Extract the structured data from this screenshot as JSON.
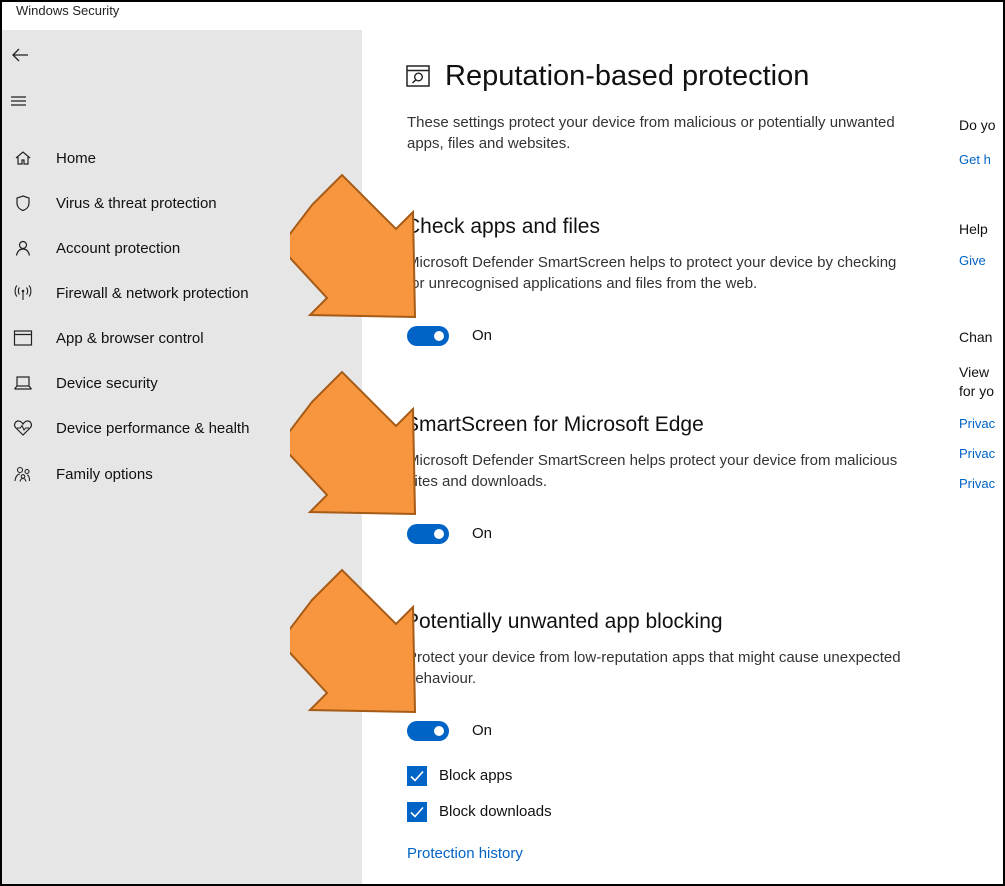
{
  "window": {
    "title": "Windows Security"
  },
  "sidebar": {
    "items": [
      {
        "label": "Home",
        "icon": "home-icon"
      },
      {
        "label": "Virus & threat protection",
        "icon": "shield-icon"
      },
      {
        "label": "Account protection",
        "icon": "person-icon"
      },
      {
        "label": "Firewall & network protection",
        "icon": "antenna-icon"
      },
      {
        "label": "App & browser control",
        "icon": "app-window-icon"
      },
      {
        "label": "Device security",
        "icon": "laptop-icon"
      },
      {
        "label": "Device performance & health",
        "icon": "heart-icon"
      },
      {
        "label": "Family options",
        "icon": "family-icon"
      }
    ]
  },
  "main": {
    "title": "Reputation-based protection",
    "description": "These settings protect your device from malicious or potentially unwanted apps, files and websites.",
    "sections": [
      {
        "title": "Check apps and files",
        "description": "Microsoft Defender SmartScreen helps to protect your device by checking for unrecognised applications and files from the web.",
        "toggle_label": "On"
      },
      {
        "title": "SmartScreen for Microsoft Edge",
        "description": "Microsoft Defender SmartScreen helps protect your device from malicious sites and downloads.",
        "toggle_label": "On"
      },
      {
        "title": "Potentially unwanted app blocking",
        "description": "Protect your device from low-reputation apps that might cause unexpected behaviour.",
        "toggle_label": "On",
        "checkboxes": [
          {
            "label": "Block apps",
            "checked": true
          },
          {
            "label": "Block downloads",
            "checked": true
          }
        ],
        "link": "Protection history"
      }
    ]
  },
  "right_panel": {
    "q1": "Do yo",
    "q1_link": "Get h",
    "help": "Help",
    "help_link": "Give",
    "change": "Chan",
    "view1": "View",
    "view2": "for yo",
    "privacy_links": [
      "Privac",
      "Privac",
      "Privac"
    ]
  },
  "colors": {
    "accent": "#0063c6",
    "sidebar_bg": "#e6e6e6",
    "arrow": "#f7963f"
  }
}
